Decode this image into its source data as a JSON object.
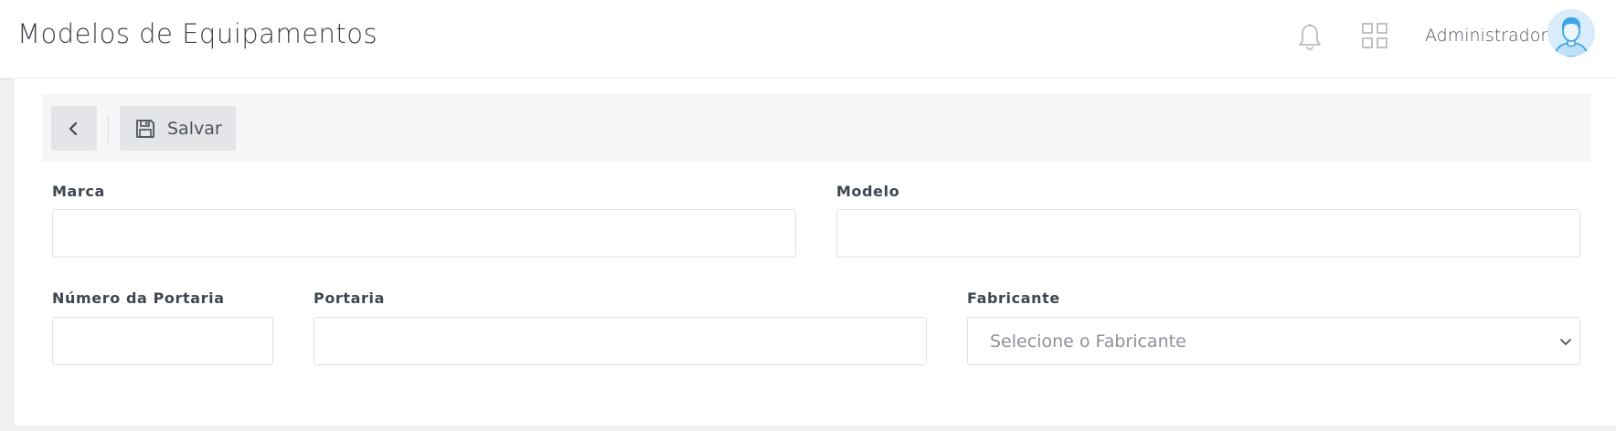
{
  "header": {
    "title": "Modelos de Equipamentos",
    "user_name": "Administrador",
    "icons": [
      "bell-icon",
      "apps-grid-icon",
      "user-avatar"
    ]
  },
  "toolbar": {
    "back_icon": "chevron-left-icon",
    "save_icon": "floppy-disk-icon",
    "save_label": "Salvar"
  },
  "form": {
    "marca": {
      "label": "Marca",
      "value": "",
      "placeholder": ""
    },
    "modelo": {
      "label": "Modelo",
      "value": "",
      "placeholder": ""
    },
    "numero_portaria": {
      "label": "Número da Portaria",
      "value": "",
      "placeholder": ""
    },
    "portaria": {
      "label": "Portaria",
      "value": "",
      "placeholder": ""
    },
    "fabricante": {
      "label": "Fabricante",
      "selected": "Selecione o Fabricante"
    }
  },
  "colors": {
    "avatar_bg": "#d8ecfb",
    "avatar_line": "#3da4e8",
    "icon_gray": "#b7bcc3"
  }
}
